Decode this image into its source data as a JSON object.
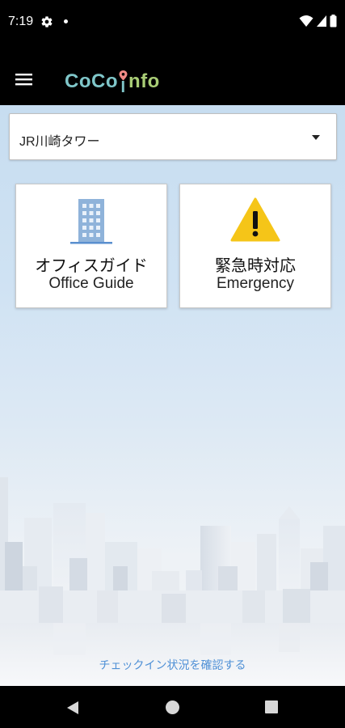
{
  "status_bar": {
    "time": "7:19",
    "icons": [
      "gear-icon",
      "notification-dot-icon",
      "wifi-icon",
      "signal-icon",
      "battery-icon"
    ]
  },
  "app_bar": {
    "logo_text": "CoCoInfo",
    "logo_parts": [
      "Co",
      "Co",
      "I",
      "nfo"
    ],
    "menu_icon": "hamburger-menu-icon"
  },
  "location_select": {
    "value": "JR川崎タワー"
  },
  "cards": [
    {
      "title_ja": "オフィスガイド",
      "title_en": "Office Guide",
      "icon": "office-building-icon"
    },
    {
      "title_ja": "緊急時対応",
      "title_en": "Emergency",
      "icon": "warning-icon"
    }
  ],
  "checkin_link": "チェックイン状況を確認する",
  "colors": {
    "logo_teal": "#7fc6c9",
    "logo_pin": "#f08b86",
    "logo_green": "#a9cd76",
    "building_blue": "#8fb3da",
    "warning_yellow": "#f5c518",
    "link_blue": "#4f90d6"
  },
  "nav_bar": {
    "icons": [
      "back-icon",
      "home-icon",
      "recents-icon"
    ]
  }
}
